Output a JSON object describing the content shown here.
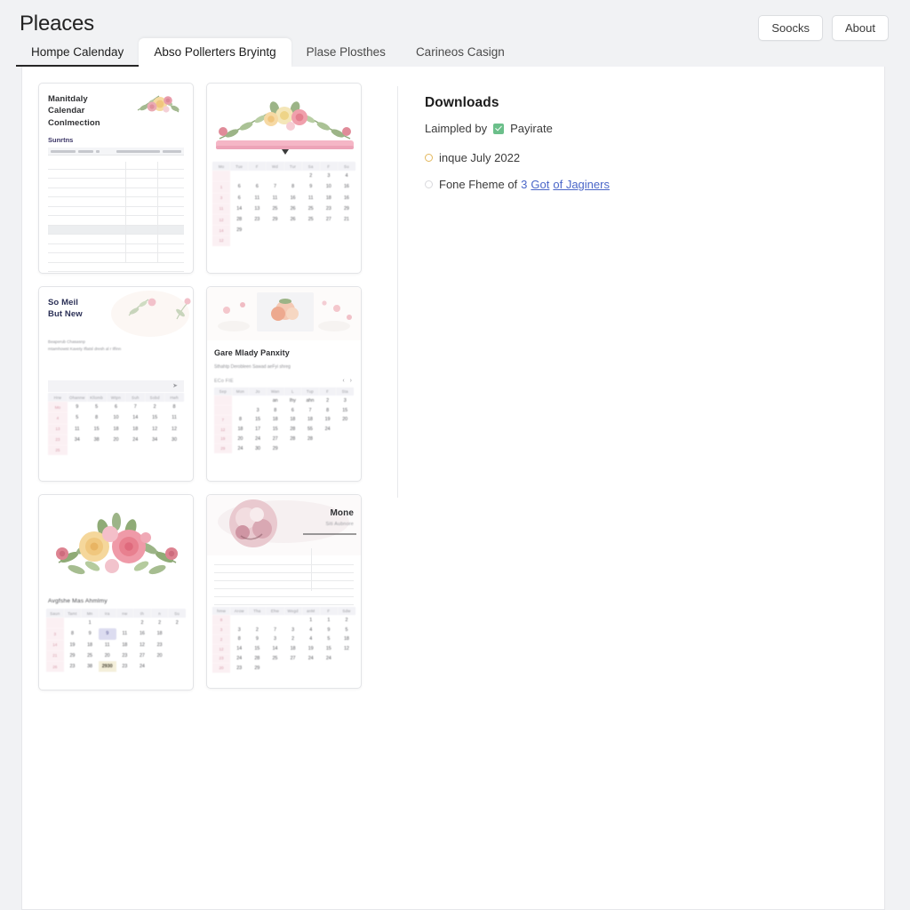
{
  "header": {
    "brand": "Pleaces",
    "buttons": [
      {
        "label": "Soocks",
        "name": "soocks-button"
      },
      {
        "label": "About",
        "name": "about-button"
      }
    ],
    "tabs": [
      {
        "label": "Hompe Calenday",
        "state": "underlined"
      },
      {
        "label": "Abso Pollerters Bryintg",
        "state": "active"
      },
      {
        "label": "Plase Plosthes",
        "state": "normal"
      },
      {
        "label": "Carineos Casign",
        "state": "normal"
      }
    ]
  },
  "sidebar": {
    "title": "Downloads",
    "sampled_label": "Laimpled by",
    "sampled_value": "Payirate",
    "options": [
      {
        "label": "inque July 2022",
        "marker": "gold"
      },
      {
        "label_pre": "Fone Fheme of",
        "count": "3",
        "link": "Got",
        "label_post": "of Jaginers",
        "marker": "plain"
      }
    ]
  },
  "gallery": {
    "cards": [
      {
        "name": "card-monthly-calendar-connection",
        "title": "Manitdaly\nCalendar\nConlmection",
        "subtitle": "Sunrtns",
        "kind": "ruled-table"
      },
      {
        "name": "card-floral-banner-calendar",
        "kind": "floral-band-calendar",
        "weekdays": [
          "Mo",
          "Tue",
          "F",
          "Wd",
          "Tur",
          "Sa",
          "F",
          "Su"
        ],
        "weeks": [
          [
            "",
            "",
            "",
            "",
            "",
            "2",
            "3",
            "4"
          ],
          [
            "1",
            "6",
            "6",
            "7",
            "8",
            "9",
            "10",
            "16"
          ],
          [
            "3",
            "6",
            "11",
            "11",
            "16",
            "11",
            "18",
            "16"
          ],
          [
            "11",
            "14",
            "13",
            "25",
            "26",
            "25",
            "23",
            "29"
          ],
          [
            "12",
            "28",
            "23",
            "29",
            "26",
            "25",
            "27",
            "21"
          ],
          [
            "14",
            "29",
            "",
            "",
            "",
            "",
            "",
            ""
          ],
          [
            "12",
            "",
            "",
            "",
            "",
            "",
            "",
            ""
          ]
        ]
      },
      {
        "name": "card-so-meil-but-new",
        "kind": "text-calendar",
        "title": "So Meil\nBut New",
        "body": "Beaperub Chasasnp\nmtamhowst Kavety Iflatsl dresh al r Ilfinn",
        "weekdays": [
          "Hrw",
          "Ohannw",
          "Kllomb",
          "Wtpn",
          "Suh",
          "Sobd",
          "Hwh"
        ],
        "weeks": [
          [
            "Mo",
            "9",
            "5",
            "6",
            "7",
            "2",
            "8"
          ],
          [
            "4",
            "5",
            "8",
            "10",
            "14",
            "15",
            "11"
          ],
          [
            "13",
            "11",
            "15",
            "18",
            "18",
            "12",
            "12"
          ],
          [
            "23",
            "34",
            "38",
            "20",
            "24",
            "34",
            "30"
          ],
          [
            "25",
            "",
            "",
            "",
            "",
            "",
            ""
          ]
        ]
      },
      {
        "name": "card-gare-mlady-panxity",
        "kind": "image-calendar",
        "title": "Gare Mlady Panxity",
        "body": "Sthahtp Derobleen Sawad aeFyi shreg",
        "toolbar_label": "ECo FIE",
        "weekdays": [
          "Sep",
          "Mon",
          "Jo",
          "Wan",
          "L",
          "Tup",
          "F",
          "Sta"
        ],
        "weeks": [
          [
            "",
            "",
            "",
            "an",
            "Ihy",
            "ahn",
            "2",
            "3"
          ],
          [
            "",
            "",
            "3",
            "8",
            "6",
            "7",
            "8",
            "15"
          ],
          [
            "7",
            "8",
            "15",
            "18",
            "18",
            "18",
            "19",
            "20"
          ],
          [
            "12",
            "18",
            "17",
            "15",
            "28",
            "55",
            "24",
            ""
          ],
          [
            "19",
            "20",
            "24",
            "27",
            "28",
            "28",
            "",
            ""
          ],
          [
            "29",
            "24",
            "30",
            "29",
            "",
            "",
            "",
            ""
          ]
        ]
      },
      {
        "name": "card-avgfshe-mas-ahmlmy",
        "kind": "bouquet-calendar",
        "title": "Avgfshe Mas Ahmlmy",
        "weekdays": [
          "Saun",
          "Tamt",
          "Mn",
          "Ira",
          "nw",
          "th",
          "n",
          "Su"
        ],
        "weeks": [
          [
            "",
            "",
            "1",
            "",
            "",
            "2",
            "2",
            "2"
          ],
          [
            "3",
            "8",
            "9",
            "9",
            "11",
            "16",
            "18"
          ],
          [
            "14",
            "19",
            "18",
            "11",
            "18",
            "12",
            "23"
          ],
          [
            "21",
            "29",
            "25",
            "20",
            "23",
            "27",
            "20"
          ],
          [
            "26",
            "23",
            "38",
            "2930",
            "23",
            "24",
            ""
          ]
        ]
      },
      {
        "name": "card-mone-monthly",
        "kind": "circle-ruled-calendar",
        "title": "Mone",
        "subtitle": "Siti Aubnore",
        "weekdays": [
          "hmw",
          "Arow",
          "Tha",
          "Ehw",
          "Wegd",
          "anM",
          "F",
          "Sdw"
        ],
        "weeks": [
          [
            "8",
            "",
            "",
            "",
            "",
            "1",
            "1",
            "2"
          ],
          [
            "3",
            "3",
            "2",
            "7",
            "3",
            "4",
            "9",
            "5"
          ],
          [
            "2",
            "8",
            "9",
            "3",
            "2",
            "4",
            "5",
            "18"
          ],
          [
            "12",
            "14",
            "15",
            "14",
            "18",
            "19",
            "15",
            "12"
          ],
          [
            "23",
            "24",
            "28",
            "25",
            "27",
            "24",
            "24",
            ""
          ],
          [
            "20",
            "23",
            "29",
            "",
            "",
            "",
            "",
            ""
          ]
        ]
      }
    ]
  },
  "colors": {
    "page_bg": "#f1f2f4",
    "panel_bg": "#ffffff",
    "accent_link": "#4a66c8",
    "check_green": "#6bbf8a",
    "marker_gold": "#e3b75c"
  }
}
